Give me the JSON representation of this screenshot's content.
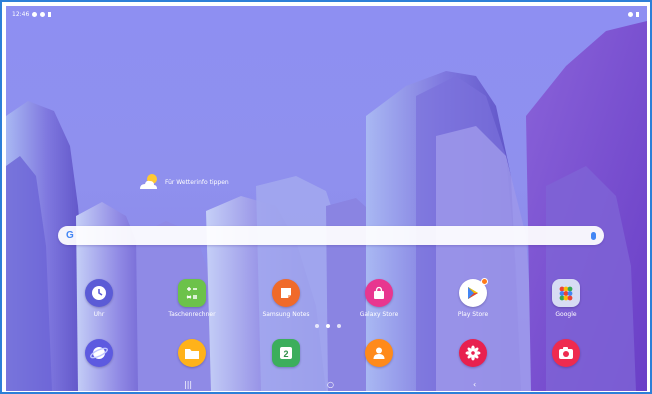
{
  "status_bar": {
    "time": "12:46"
  },
  "weather": {
    "label": "Für Wetterinfo tippen"
  },
  "search": {
    "logo": "G"
  },
  "apps_row1": [
    {
      "label": "Uhr",
      "icon": "clock-icon",
      "color": "#5b5bd6"
    },
    {
      "label": "Taschenrechner",
      "icon": "calculator-icon",
      "color": "#6cc24a"
    },
    {
      "label": "Samsung Notes",
      "icon": "notes-icon",
      "color": "#f06a2a"
    },
    {
      "label": "Galaxy Store",
      "icon": "shopping-bag-icon",
      "color": "#e8368f"
    },
    {
      "label": "Play Store",
      "icon": "play-store-icon",
      "color": "#ffffff"
    },
    {
      "label": "Google",
      "icon": "google-folder-icon",
      "color": "#d7dcf3"
    }
  ],
  "apps_row2": [
    {
      "label": "",
      "icon": "internet-icon",
      "color": "#5d5ae0"
    },
    {
      "label": "",
      "icon": "folder-icon",
      "color": "#ffb21a"
    },
    {
      "label": "",
      "icon": "calendar-icon",
      "color": "#3cae5c"
    },
    {
      "label": "",
      "icon": "contacts-icon",
      "color": "#ff8a1a"
    },
    {
      "label": "",
      "icon": "gallery-icon",
      "color": "#e8204f"
    },
    {
      "label": "",
      "icon": "camera-icon",
      "color": "#ee2b4f"
    }
  ],
  "calendar_day": "2",
  "nav": {
    "recents": "|||",
    "home": "○",
    "back": "‹"
  }
}
